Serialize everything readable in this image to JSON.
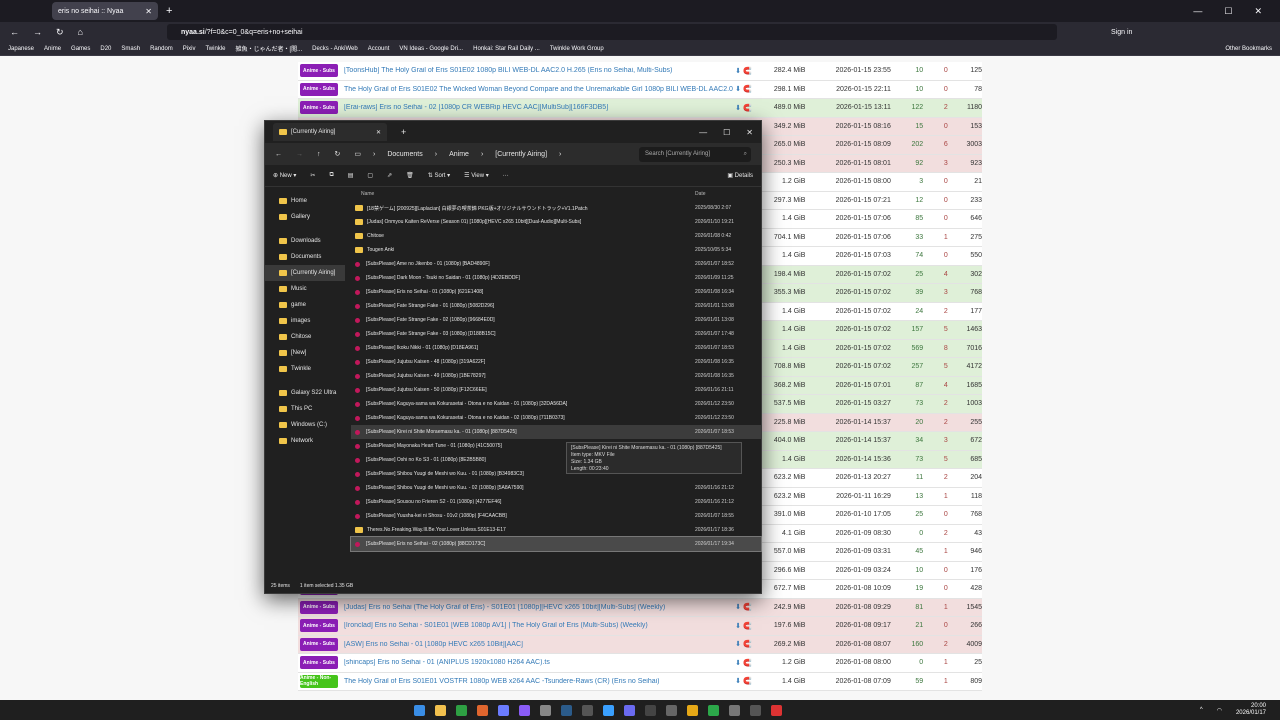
{
  "browser": {
    "tab_title": "eris no seihai :: Nyaa",
    "url_host": "nyaa.si",
    "url_rest": "/?f=0&c=0_0&q=eris+no+seihai",
    "signin": "Sign in",
    "bookmarks": [
      "Japanese",
      "Anime",
      "Games",
      "D20",
      "Smash",
      "Random",
      "Pixiv",
      "Twinkle",
      "雑魚・じゃんだ者・[閲...",
      "Decks - AnkiWeb",
      "Account",
      "VN Ideas - Google Dri...",
      "Honkai: Star Rail Daily ...",
      "Twinkle Work Group"
    ],
    "other_bookmarks": "Other Bookmarks"
  },
  "torrents": [
    {
      "cat": "Anime - Subs",
      "color": "purple",
      "style": "d",
      "name": "[ToonsHub] The Holy Grail of Eris S01E02 1080p BILI WEB-DL AAC2.0 H.265 (Eris no Seihai, Multi-Subs)",
      "size": "282.4 MiB",
      "date": "2026-01-15 23:55",
      "se": "10",
      "le": "0",
      "dl": "125"
    },
    {
      "cat": "Anime - Subs",
      "color": "purple",
      "style": "d",
      "name": "The Holy Grail of Eris S01E02 The Wicked Woman Beyond Compare and the Unremarkable Girl 1080p BILI WEB-DL AAC2.0 ...",
      "size": "298.1 MiB",
      "date": "2026-01-15 22:11",
      "se": "10",
      "le": "0",
      "dl": "78"
    },
    {
      "cat": "Anime - Subs",
      "color": "purple",
      "style": "s",
      "name": "[Erai-raws] Eris no Seihai - 02 [1080p CR WEBRip HEVC AAC][MultiSub][166F3DB5]",
      "size": "489.0 MiB",
      "date": "2026-01-15 13:11",
      "se": "122",
      "le": "2",
      "dl": "1180"
    },
    {
      "cat": "",
      "color": "purple",
      "style": "r",
      "name": "",
      "size": "349.2 MiB",
      "date": "2026-01-15 08:16",
      "se": "15",
      "le": "0",
      "dl": "153"
    },
    {
      "cat": "",
      "color": "purple",
      "style": "r",
      "name": "",
      "size": "265.0 MiB",
      "date": "2026-01-15 08:09",
      "se": "202",
      "le": "6",
      "dl": "3003"
    },
    {
      "cat": "",
      "color": "purple",
      "style": "r",
      "name": "",
      "size": "250.3 MiB",
      "date": "2026-01-15 08:01",
      "se": "92",
      "le": "3",
      "dl": "923"
    },
    {
      "cat": "",
      "color": "purple",
      "style": "d",
      "name": "",
      "size": "1.2 GiB",
      "date": "2026-01-15 08:00",
      "se": "3",
      "le": "0",
      "dl": "21"
    },
    {
      "cat": "",
      "color": "purple",
      "style": "d",
      "name": "",
      "size": "297.3 MiB",
      "date": "2026-01-15 07:21",
      "se": "12",
      "le": "0",
      "dl": "233"
    },
    {
      "cat": "",
      "color": "purple",
      "style": "d",
      "name": "",
      "size": "1.4 GiB",
      "date": "2026-01-15 07:06",
      "se": "85",
      "le": "0",
      "dl": "646"
    },
    {
      "cat": "",
      "color": "purple",
      "style": "d",
      "name": "",
      "size": "704.1 MiB",
      "date": "2026-01-15 07:06",
      "se": "33",
      "le": "1",
      "dl": "275"
    },
    {
      "cat": "",
      "color": "purple",
      "style": "d",
      "name": "",
      "size": "1.4 GiB",
      "date": "2026-01-15 07:03",
      "se": "74",
      "le": "0",
      "dl": "550"
    },
    {
      "cat": "",
      "color": "purple",
      "style": "s",
      "name": "",
      "size": "198.4 MiB",
      "date": "2026-01-15 07:02",
      "se": "25",
      "le": "4",
      "dl": "302"
    },
    {
      "cat": "",
      "color": "purple",
      "style": "s",
      "name": "",
      "size": "355.3 MiB",
      "date": "2026-01-15 07:02",
      "se": "39",
      "le": "3",
      "dl": "768"
    },
    {
      "cat": "",
      "color": "purple",
      "style": "d",
      "name": "",
      "size": "1.4 GiB",
      "date": "2026-01-15 07:02",
      "se": "24",
      "le": "2",
      "dl": "177"
    },
    {
      "cat": "",
      "color": "purple",
      "style": "s",
      "name": "",
      "size": "1.4 GiB",
      "date": "2026-01-15 07:02",
      "se": "157",
      "le": "5",
      "dl": "1463"
    },
    {
      "cat": "",
      "color": "purple",
      "style": "s",
      "name": "",
      "size": "1.4 GiB",
      "date": "2026-01-15 07:02",
      "se": "569",
      "le": "8",
      "dl": "7016"
    },
    {
      "cat": "",
      "color": "purple",
      "style": "s",
      "name": "",
      "size": "708.8 MiB",
      "date": "2026-01-15 07:02",
      "se": "257",
      "le": "5",
      "dl": "4172"
    },
    {
      "cat": "",
      "color": "purple",
      "style": "s",
      "name": "",
      "size": "368.2 MiB",
      "date": "2026-01-15 07:01",
      "se": "87",
      "le": "4",
      "dl": "1685"
    },
    {
      "cat": "",
      "color": "purple",
      "style": "s",
      "name": "",
      "size": "537.5 MiB",
      "date": "2026-01-15 03:27",
      "se": "73",
      "le": "2",
      "dl": "1003"
    },
    {
      "cat": "",
      "color": "purple",
      "style": "r",
      "name": "",
      "size": "225.8 MiB",
      "date": "2026-01-14 15:37",
      "se": "20",
      "le": "2",
      "dl": "255"
    },
    {
      "cat": "",
      "color": "purple",
      "style": "s",
      "name": "",
      "size": "404.0 MiB",
      "date": "2026-01-14 15:37",
      "se": "34",
      "le": "3",
      "dl": "672"
    },
    {
      "cat": "",
      "color": "purple",
      "style": "s",
      "name": "",
      "size": "1.4 GiB",
      "date": "2026-01-14 15:36",
      "se": "73",
      "le": "5",
      "dl": "685"
    },
    {
      "cat": "",
      "color": "purple",
      "style": "d",
      "name": "",
      "size": "623.2 MiB",
      "date": "2026-01-13 20:27",
      "se": "11",
      "le": "2",
      "dl": "204"
    },
    {
      "cat": "",
      "color": "purple",
      "style": "d",
      "name": "",
      "size": "623.2 MiB",
      "date": "2026-01-11 16:29",
      "se": "13",
      "le": "1",
      "dl": "118"
    },
    {
      "cat": "",
      "color": "purple",
      "style": "d",
      "name": "",
      "size": "391.0 MiB",
      "date": "2026-01-10 17:05",
      "se": "25",
      "le": "0",
      "dl": "768"
    },
    {
      "cat": "",
      "color": "purple",
      "style": "d",
      "name": "",
      "size": "4.1 GiB",
      "date": "2026-01-09 08:30",
      "se": "0",
      "le": "2",
      "dl": "43"
    },
    {
      "cat": "",
      "color": "purple",
      "style": "d",
      "name": "",
      "size": "557.0 MiB",
      "date": "2026-01-09 03:31",
      "se": "45",
      "le": "1",
      "dl": "946"
    },
    {
      "cat": "",
      "color": "purple",
      "style": "d",
      "name": "",
      "size": "296.6 MiB",
      "date": "2026-01-09 03:24",
      "se": "10",
      "le": "0",
      "dl": "176"
    },
    {
      "cat": "",
      "color": "purple",
      "style": "d",
      "name": "",
      "size": "672.7 MiB",
      "date": "2026-01-08 10:09",
      "se": "19",
      "le": "0",
      "dl": "428"
    },
    {
      "cat": "Anime - Subs",
      "color": "purple",
      "style": "r",
      "name": "[Judas] Eris no Seihai (The Holy Grail of Eris) - S01E01 [1080p][HEVC x265 10bit][Multi-Subs] (Weekly)",
      "size": "242.9 MiB",
      "date": "2026-01-08 09:29",
      "se": "81",
      "le": "1",
      "dl": "1545"
    },
    {
      "cat": "Anime - Subs",
      "color": "purple",
      "style": "r",
      "name": "[Ironclad] Eris no Seihai - S01E01 [WEB 1080p AV1] | The Holy Grail of Eris (Multi-Subs) (Weekly)",
      "size": "197.6 MiB",
      "date": "2026-01-08 09:17",
      "se": "21",
      "le": "0",
      "dl": "266"
    },
    {
      "cat": "Anime - Subs",
      "color": "purple",
      "style": "r",
      "name": "[ASW] Eris no Seihai - 01 [1080p HEVC x265 10Bit][AAC]",
      "size": "269.2 MiB",
      "date": "2026-01-08 08:07",
      "se": "160",
      "le": "2",
      "dl": "4009"
    },
    {
      "cat": "Anime - Subs",
      "color": "purple",
      "style": "d",
      "name": "[shincaps] Eris no Seihai - 01 (ANIPLUS 1920x1080 H264 AAC).ts",
      "size": "1.2 GiB",
      "date": "2026-01-08 08:00",
      "se": "0",
      "le": "1",
      "dl": "25"
    },
    {
      "cat": "Anime - Non-English",
      "color": "green",
      "style": "d",
      "name": "The Holy Grail of Eris S01E01 VOSTFR 1080p WEB x264 AAC -Tsundere-Raws (CR) (Eris no Seihai)",
      "size": "1.4 GiB",
      "date": "2026-01-08 07:09",
      "se": "59",
      "le": "1",
      "dl": "809"
    }
  ],
  "explorer": {
    "tab_title": "[Currently Airing]",
    "path": [
      "Documents",
      "Anime",
      "[Currently Airing]"
    ],
    "search_placeholder": "Search [Currently Airing]",
    "toolbar": {
      "new": "New",
      "sort": "Sort",
      "view": "View",
      "details": "Details"
    },
    "col_name": "Name",
    "col_date": "Date",
    "nav": [
      "Home",
      "Gallery",
      "Downloads",
      "Documents",
      "[Currently Airing]",
      "Music",
      "game",
      "images",
      "Chitose",
      "[New]",
      "Twinkle",
      "Galaxy S22 Ultra",
      "This PC",
      "Windows (C:)",
      "Network"
    ],
    "files": [
      {
        "type": "folder",
        "name": "[18禁ゲーム] [200925][Laplacian] 白銀夢の喫茶錦 PKG版+オリジナルサウンドトラック+V1.1Patch",
        "date": "2025/08/30 2:07"
      },
      {
        "type": "folder",
        "name": "[Judas] Onmyou Kaiten ReVerse (Season 01) [1080p][HEVC x265 10bit][Dual-Audio][Multi-Subs]",
        "date": "2026/01/10 19:21"
      },
      {
        "type": "folder",
        "name": "Chitose",
        "date": "2026/01/08 0:42"
      },
      {
        "type": "folder",
        "name": "Tougen Anki",
        "date": "2025/10/05 5:34"
      },
      {
        "type": "vid",
        "name": "[SubsPlease] Ame no Jikenbo - 01 (1080p) [BAD4890F]",
        "date": "2026/01/07 18:52"
      },
      {
        "type": "vid",
        "name": "[SubsPlease] Dark Moon - Tsuki no Saidan - 01 (1080p) [4D2EBDDF]",
        "date": "2026/01/09 11:25"
      },
      {
        "type": "vid",
        "name": "[SubsPlease] Eris no Seihai - 01 (1080p) [621E1408]",
        "date": "2026/01/08 16:34"
      },
      {
        "type": "vid",
        "name": "[SubsPlease] Fate Strange Fake - 01 (1080p) [5082D296]",
        "date": "2026/01/01 13:08"
      },
      {
        "type": "vid",
        "name": "[SubsPlease] Fate Strange Fake - 02 (1080p) [96684E0D]",
        "date": "2026/01/01 13:08"
      },
      {
        "type": "vid",
        "name": "[SubsPlease] Fate Strange Fake - 03 (1080p) [D188B15C]",
        "date": "2026/01/07 17:48"
      },
      {
        "type": "vid",
        "name": "[SubsPlease] Ikoku Nikki - 01 (1080p) [D18EA961]",
        "date": "2026/01/07 18:53"
      },
      {
        "type": "vid",
        "name": "[SubsPlease] Jujutsu Kaisen - 48 (1080p) [319A622F]",
        "date": "2026/01/08 16:35"
      },
      {
        "type": "vid",
        "name": "[SubsPlease] Jujutsu Kaisen - 49 (1080p) [1BE78297]",
        "date": "2026/01/08 16:35"
      },
      {
        "type": "vid",
        "name": "[SubsPlease] Jujutsu Kaisen - 50 (1080p) [F12C66EE]",
        "date": "2026/01/16 21:11"
      },
      {
        "type": "vid",
        "name": "[SubsPlease] Kaguya-sama wa Kokurasetai - Otona e no Kaidan - 01 (1080p) [32DA56DA]",
        "date": "2026/01/12 23:50"
      },
      {
        "type": "vid",
        "name": "[SubsPlease] Kaguya-sama wa Kokurasetai - Otona e no Kaidan - 02 (1080p) [711B0373]",
        "date": "2026/01/12 23:50"
      },
      {
        "type": "vid",
        "name": "[SubsPlease] Kirei ni Shite Moraemasu ka. - 01 (1080p) [887D5425]",
        "date": "2026/01/07 18:53",
        "hl": true
      },
      {
        "type": "vid",
        "name": "[SubsPlease] Mayonaka Heart Tune - 01 (1080p) [41C50075]",
        "date": ""
      },
      {
        "type": "vid",
        "name": "[SubsPlease] Oshi no Ko S3 - 01 (1080p) [8E2B5B80]",
        "date": ""
      },
      {
        "type": "vid",
        "name": "[SubsPlease] Shibou Yuugi de Meshi wo Kuu. - 01 (1080p) [B34983C3]",
        "date": ""
      },
      {
        "type": "vid",
        "name": "[SubsPlease] Shibou Yuugi de Meshi wo Kuu. - 02 (1080p) [5A8A7590]",
        "date": "2026/01/16 21:12"
      },
      {
        "type": "vid",
        "name": "[SubsPlease] Sousou no Frieren S2 - 01 (1080p) [4277EF46]",
        "date": "2026/01/16 21:12"
      },
      {
        "type": "vid",
        "name": "[SubsPlease] Yuusha-kei ni Shosu - 01v2 (1080p) [F4CAACBB]",
        "date": "2026/01/07 18:55"
      },
      {
        "type": "folder",
        "name": "Theres.No.Freaking.Way.Ill.Be.Your.Lover.Unless.S01E13-E17",
        "date": "2026/01/17 18:36"
      },
      {
        "type": "vid",
        "name": "[SubsPlease] Eris no Seihai - 02 (1080p) [88CD173C]",
        "date": "2026/01/17 19:34",
        "sel": true
      }
    ],
    "tooltip": [
      "[SubsPlease] Kirei ni Shite Moraemasu ka. - 01 (1080p) [887D5425]",
      "Item type: MKV File",
      "Size: 1.34 GB",
      "Length: 00:23:40"
    ],
    "status_count": "25 items",
    "status_selected": "1 item selected  1.35 GB"
  },
  "taskbar": {
    "time": "20:00",
    "date": "2026/01/17"
  }
}
